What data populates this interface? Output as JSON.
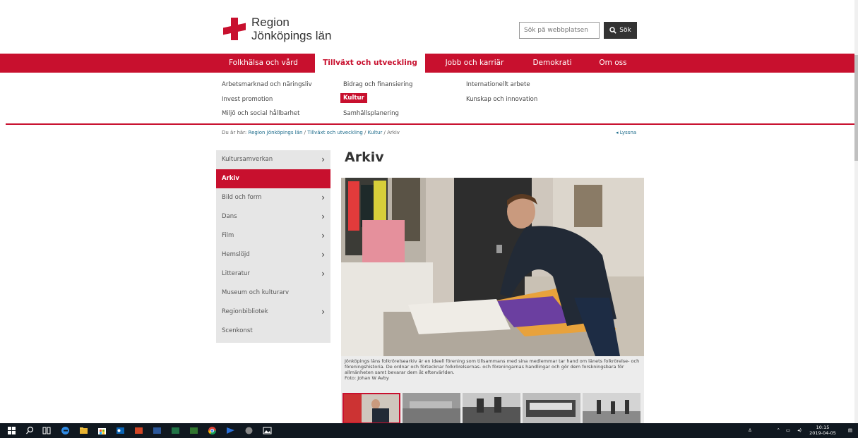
{
  "header": {
    "logo_line1": "Region",
    "logo_line2": "Jönköpings län",
    "search_placeholder": "Sök på webbplatsen",
    "search_button": "Sök"
  },
  "mainnav": {
    "items": [
      "Folkhälsa och vård",
      "Tillväxt och utveckling",
      "Jobb och karriär",
      "Demokrati",
      "Om oss"
    ],
    "active_index": 1
  },
  "subnav": {
    "col1": [
      "Arbetsmarknad och näringsliv",
      "Invest promotion",
      "Miljö och social hållbarhet"
    ],
    "col2": [
      "Bidrag och finansiering",
      "Kultur",
      "Samhällsplanering"
    ],
    "col3": [
      "Internationellt arbete",
      "Kunskap och innovation"
    ],
    "active": "Kultur"
  },
  "breadcrumb": {
    "prefix": "Du är här:",
    "items": [
      "Region Jönköpings län",
      "Tillväxt och utveckling",
      "Kultur",
      "Arkiv"
    ],
    "separator": "/"
  },
  "listen_label": "Lyssna",
  "sidebar": {
    "items": [
      {
        "label": "Kultursamverkan",
        "has_children": true
      },
      {
        "label": "Arkiv",
        "has_children": false,
        "active": true
      },
      {
        "label": "Bild och form",
        "has_children": true
      },
      {
        "label": "Dans",
        "has_children": true
      },
      {
        "label": "Film",
        "has_children": true
      },
      {
        "label": "Hemslöjd",
        "has_children": true
      },
      {
        "label": "Litteratur",
        "has_children": true
      },
      {
        "label": "Museum och kulturarv",
        "has_children": false
      },
      {
        "label": "Regionbibliotek",
        "has_children": true
      },
      {
        "label": "Scenkonst",
        "has_children": false
      }
    ]
  },
  "page_title": "Arkiv",
  "caption": {
    "text": "Jönköpings läns folkrörelsearkiv är en ideell förening som tillsammans med sina medlemmar tar hand om länets folkrörelse- och föreningshistoria. De ordnar och förtecknar folkrörelsernas- och föreningarnas handlingar och gör dem forskningsbara för allmänheten samt bevarar dem åt eftervärlden.",
    "credit": "Foto: Johan W Avby"
  },
  "taskbar": {
    "time": "10:15",
    "date": "2019-04-05"
  },
  "colors": {
    "brand": "#c8102e",
    "taskbar": "#101820"
  }
}
